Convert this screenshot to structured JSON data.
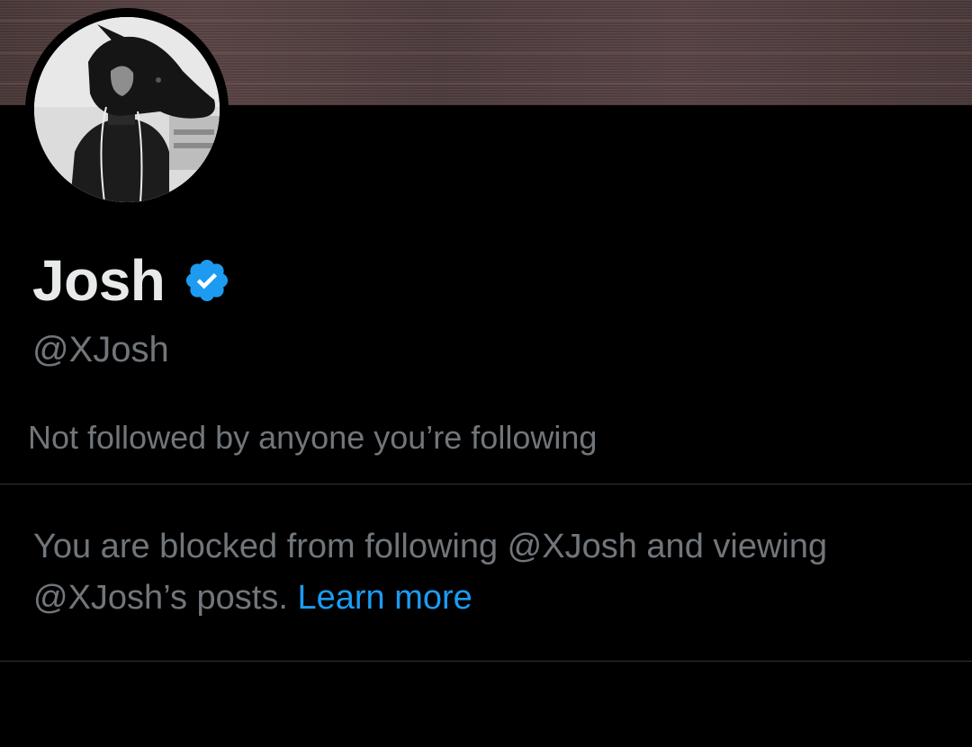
{
  "profile": {
    "display_name": "Josh",
    "handle": "@XJosh",
    "verified_icon": "verified-badge-icon",
    "followers_you_know": "Not followed by anyone you’re following"
  },
  "blocked_notice": {
    "text": "You are blocked from following @XJosh and viewing @XJosh’s posts. ",
    "link_label": "Learn more"
  },
  "colors": {
    "background": "#000000",
    "primary_text": "#e7e9ea",
    "secondary_text": "#71767b",
    "link": "#1d9bf0",
    "verified_badge": "#1d9bf0",
    "divider": "#2f3336",
    "banner": "#4f3d3e"
  }
}
